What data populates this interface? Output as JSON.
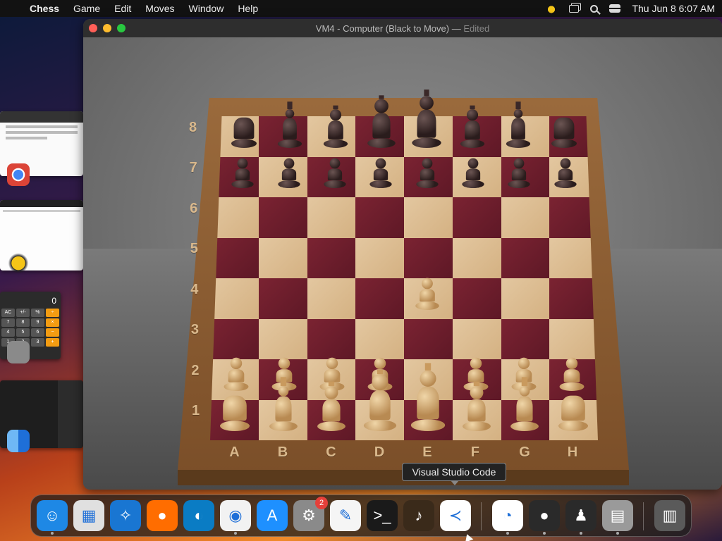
{
  "menubar": {
    "apple_glyph": "",
    "app_name": "Chess",
    "items": [
      "Game",
      "Edit",
      "Moves",
      "Window",
      "Help"
    ],
    "clock": "Thu Jun 8  6:07 AM"
  },
  "window": {
    "title": "VM4 - Computer   (Black to Move)",
    "separator": "—",
    "status": "Edited"
  },
  "board": {
    "ranks": [
      "8",
      "7",
      "6",
      "5",
      "4",
      "3",
      "2",
      "1"
    ],
    "files": [
      "A",
      "B",
      "C",
      "D",
      "E",
      "F",
      "G",
      "H"
    ]
  },
  "calculator_thumb": {
    "display": "0",
    "keys": [
      "AC",
      "+/-",
      "%",
      "÷",
      "7",
      "8",
      "9",
      "×",
      "4",
      "5",
      "6",
      "−",
      "1",
      "2",
      "3",
      "+"
    ]
  },
  "tooltip": {
    "text": "Visual Studio Code"
  },
  "dock": {
    "items": [
      {
        "name": "finder-icon",
        "glyph": "☺",
        "color": "#1e88e5"
      },
      {
        "name": "launchpad-icon",
        "glyph": "▦",
        "color": "#e0e0e0"
      },
      {
        "name": "safari-icon",
        "glyph": "✧",
        "color": "#1976d2"
      },
      {
        "name": "firefox-icon",
        "glyph": "●",
        "color": "#ff6d00"
      },
      {
        "name": "edge-icon",
        "glyph": "◐",
        "color": "#0a7cc4"
      },
      {
        "name": "chrome-icon",
        "glyph": "◉",
        "color": "#f2f2f2"
      },
      {
        "name": "app-store-icon",
        "glyph": "A",
        "color": "#1e90ff"
      },
      {
        "name": "system-settings-icon",
        "glyph": "⚙",
        "color": "#8a8a8a"
      },
      {
        "name": "textedit-icon",
        "glyph": "✎",
        "color": "#f5f5f5"
      },
      {
        "name": "terminal-icon",
        "glyph": ">_",
        "color": "#1a1a1a"
      },
      {
        "name": "garageband-icon",
        "glyph": "♪",
        "color": "#3a2a1a"
      },
      {
        "name": "vscode-icon",
        "glyph": "≺",
        "color": "#ffffff"
      },
      {
        "name": "app-green-icon",
        "glyph": "◔",
        "color": "#ffffff"
      },
      {
        "name": "bee-app-icon",
        "glyph": "●",
        "color": "#2a2a2a"
      },
      {
        "name": "chess-app-icon",
        "glyph": "♟",
        "color": "#2a2a2a"
      },
      {
        "name": "calculator-icon",
        "glyph": "▤",
        "color": "#9a9a9a"
      },
      {
        "name": "trash-icon",
        "glyph": "▥",
        "color": "#5a5a5a"
      }
    ],
    "settings_badge": "2"
  }
}
